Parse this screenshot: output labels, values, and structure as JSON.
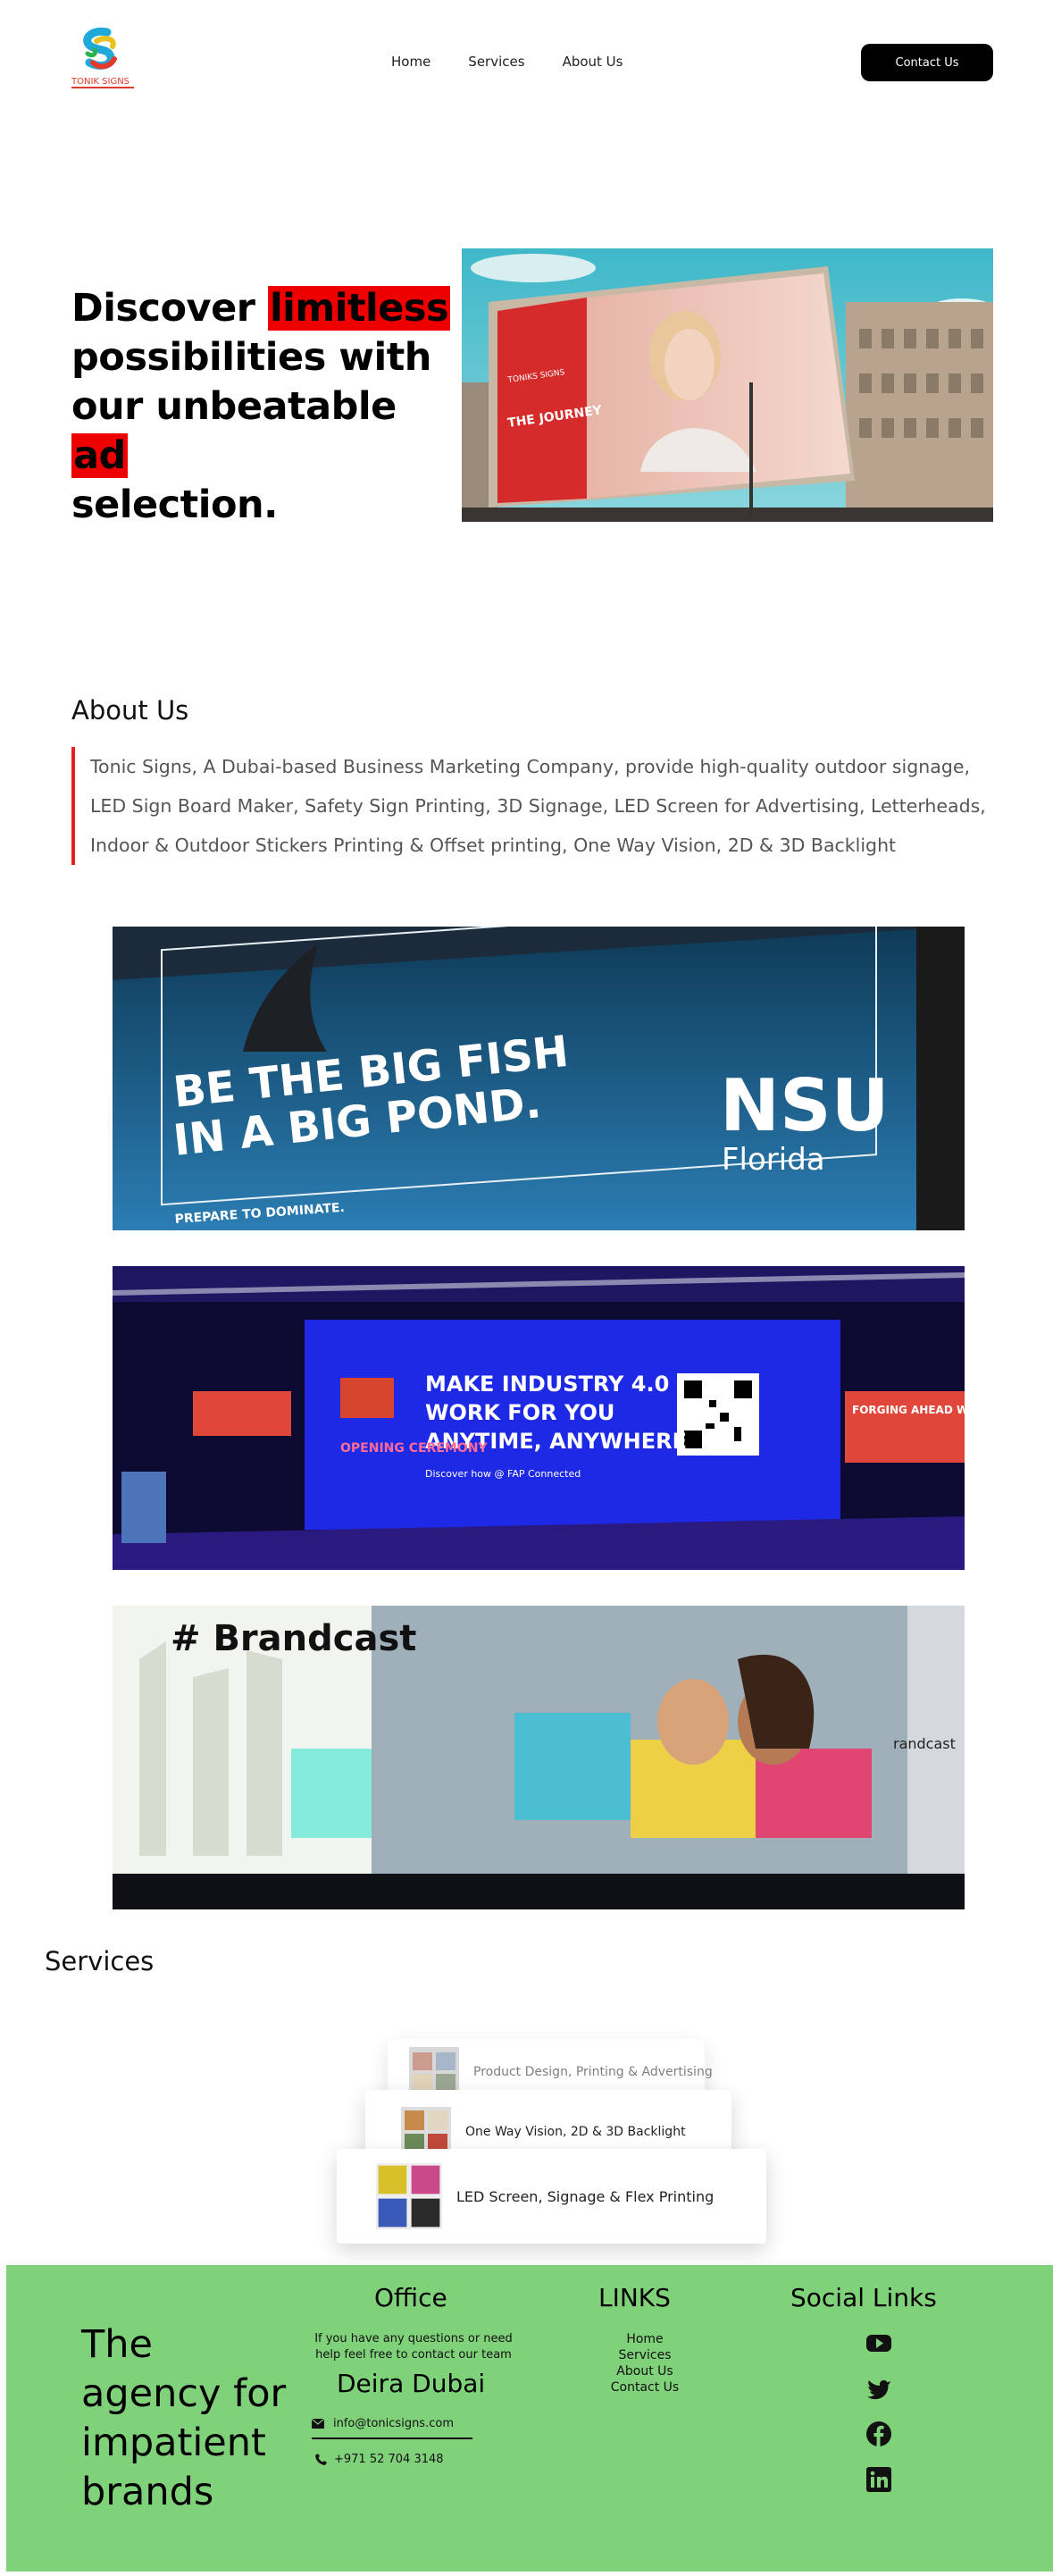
{
  "header": {
    "logo_text": "TONIK SIGNS",
    "nav": [
      "Home",
      "Services",
      "About Us"
    ],
    "contact_label": "Contact Us"
  },
  "hero": {
    "t1": "Discover ",
    "t1_hl": "limitless",
    "t2": "possibilities with",
    "t3": "our unbeatable ",
    "t3_hl": "ad",
    "t4": "selection.",
    "image_texts": {
      "title": "THE JOURNEY",
      "brand": "TONIKS SIGNS"
    }
  },
  "about": {
    "heading": "About Us",
    "body": "Tonic Signs, A Dubai-based Business Marketing Company, provide high-quality outdoor signage, LED Sign Board Maker, Safety Sign Printing, 3D Signage, LED Screen for Advertising, Letterheads, Indoor & Outdoor Stickers Printing & Offset printing, One Way Vision, 2D & 3D Backlight"
  },
  "banners": {
    "b1": {
      "line1": "BE THE BIG FISH",
      "line2": "IN A BIG POND.",
      "tagline": "PREPARE TO DOMINATE.",
      "brand": "NSU",
      "brand_sub": "Florida"
    },
    "b2": {
      "line1": "MAKE INDUSTRY 4.0",
      "line2": "WORK FOR YOU",
      "line3": "ANYTIME, ANYWHERE",
      "sub": "Discover how @ FAP Connected",
      "left": "OPENING CEREMONY",
      "right": "FORGING AHEAD WITH INDUSTRY"
    },
    "b3": {
      "hashtag": "# Brandcast",
      "right_text": "randcast"
    }
  },
  "services": {
    "heading": "Services",
    "items": [
      {
        "label": "Product Design, Printing & Advertising"
      },
      {
        "label": "One Way Vision, 2D & 3D Backlight"
      },
      {
        "label": "LED Screen, Signage & Flex Printing"
      }
    ]
  },
  "footer": {
    "tagline": "The agency for impatient brands",
    "office_heading": "Office",
    "office_text": "If you have any questions or need help feel free to contact our team",
    "city": "Deira Dubai",
    "email": "info@tonicsigns.com",
    "phone": "+971 52 704 3148",
    "links_heading": "LINKS",
    "links": [
      "Home",
      "Services",
      "About Us",
      "Contact Us"
    ],
    "social_heading": "Social Links",
    "social": [
      "youtube-icon",
      "twitter-icon",
      "facebook-icon",
      "linkedin-icon"
    ],
    "bg_color": "#80d27a"
  },
  "colors": {
    "accent_red": "#ee0000",
    "button_black": "#000000"
  }
}
